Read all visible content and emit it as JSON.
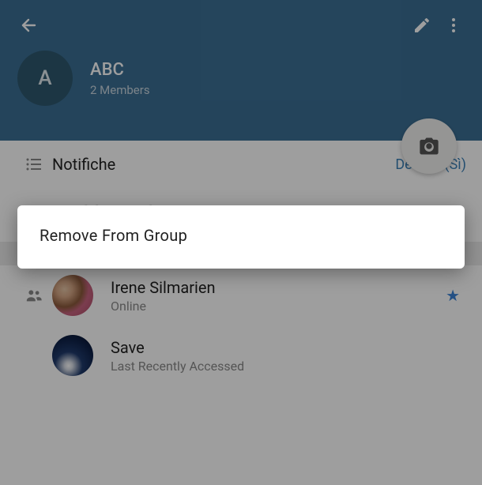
{
  "header": {
    "avatar_letter": "A",
    "group_name": "ABC",
    "members_count": "2 Members"
  },
  "settings": {
    "notifications_label": "Notifiche",
    "notifications_value": "Default (Sì)"
  },
  "actions": {
    "add_member": "Add Member"
  },
  "members": [
    {
      "name": "Irene Silmarien",
      "status": "Online",
      "starred": true
    },
    {
      "name": "Save",
      "status": "Last Recently Accessed",
      "starred": false
    }
  ],
  "popup": {
    "remove_label": "Remove From Group"
  }
}
